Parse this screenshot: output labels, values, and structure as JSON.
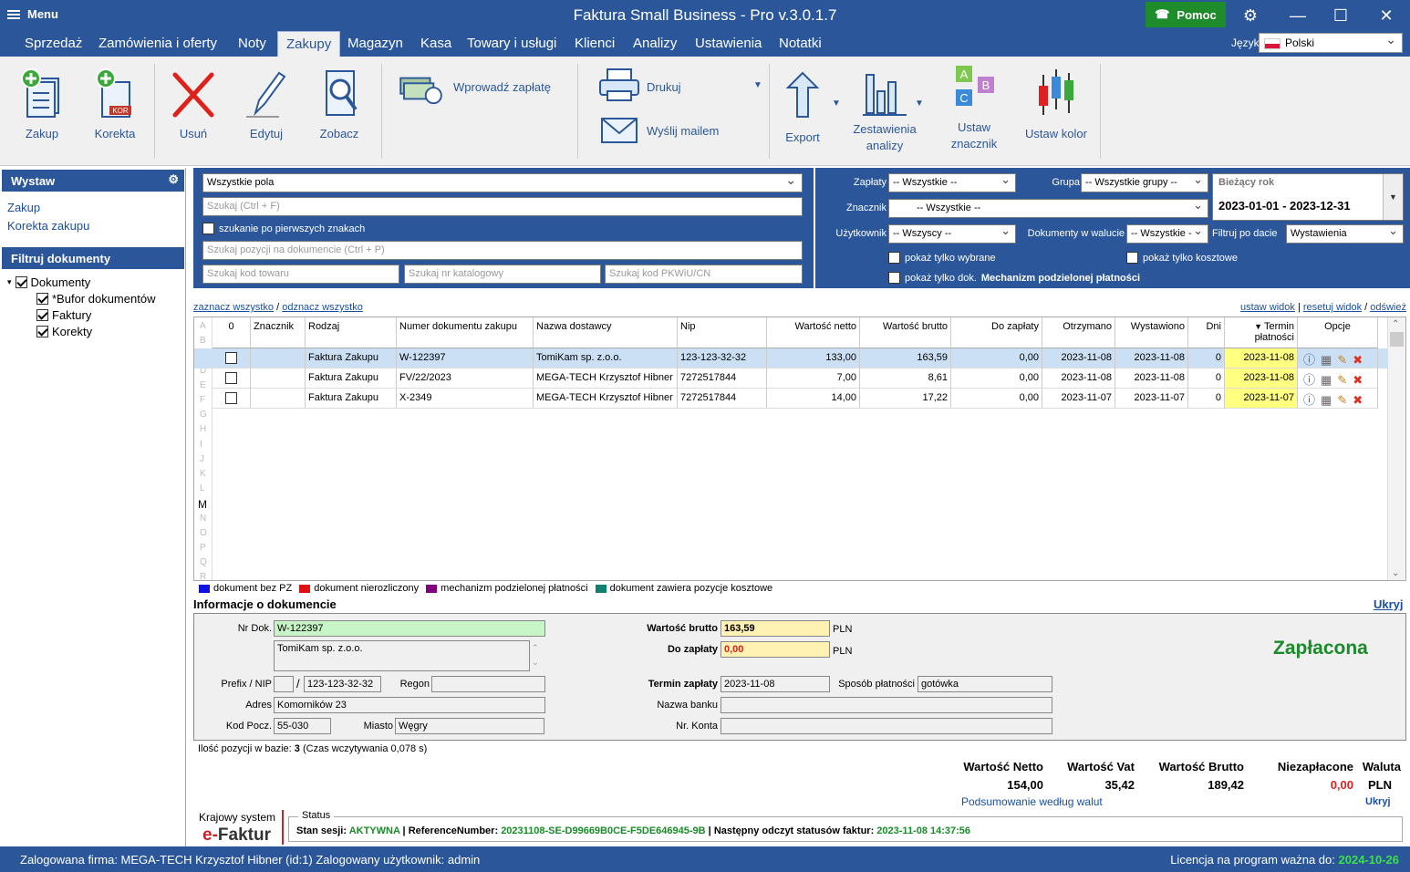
{
  "window": {
    "menu_label": "Menu",
    "title": "Faktura Small Business - Pro v.3.0.1.7",
    "help_label": "Pomoc"
  },
  "menubar": {
    "tabs": [
      "Sprzedaż",
      "Zamówienia i oferty",
      "Noty",
      "Zakupy",
      "Magazyn",
      "Kasa",
      "Towary i usługi",
      "Klienci",
      "Analizy",
      "Ustawienia",
      "Notatki"
    ],
    "active_tab": "Zakupy",
    "language_label": "Język",
    "language_value": "Polski"
  },
  "ribbon": {
    "zakup": "Zakup",
    "korekta": "Korekta",
    "usun": "Usuń",
    "edytuj": "Edytuj",
    "zobacz": "Zobacz",
    "wprowadz": "Wprowadź zapłatę",
    "drukuj": "Drukuj",
    "wyslij": "Wyślij mailem",
    "export": "Export",
    "zestawienia": "Zestawienia analizy",
    "znacznik": "Ustaw znacznik",
    "kolor": "Ustaw kolor",
    "kor_badge": "KOR"
  },
  "left": {
    "wystaw_title": "Wystaw",
    "wystaw_items": [
      "Zakup",
      "Korekta zakupu"
    ],
    "filter_title": "Filtruj dokumenty",
    "tree": [
      "Dokumenty",
      "*Bufor dokumentów",
      "Faktury",
      "Korekty"
    ]
  },
  "search": {
    "field_select": "Wszystkie pola",
    "search_placeholder": "Szukaj (Ctrl + F)",
    "first_chars_label": "szukanie po pierwszych znakach",
    "positions_placeholder": "Szukaj pozycji na dokumencie (Ctrl + P)",
    "code_placeholder": "Szukaj kod towaru",
    "catalog_placeholder": "Szukaj nr katalogowy",
    "pkwiu_placeholder": "Szukaj kod PKWiU/CN"
  },
  "filters": {
    "zaplaty_label": "Zapłaty",
    "zaplaty_value": "-- Wszystkie --",
    "grupa_label": "Grupa",
    "grupa_value": "-- Wszystkie grupy --",
    "znacznik_label": "Znacznik",
    "znacznik_value": "-- Wszystkie --",
    "uzytkownik_label": "Użytkownik",
    "uzytkownik_value": "-- Wszyscy --",
    "waluta_label": "Dokumenty w walucie",
    "waluta_value": "-- Wszystkie -",
    "period_label": "Bieżący rok",
    "period_value": "2023-01-01 - 2023-12-31",
    "filtruj_label": "Filtruj po dacie",
    "filtruj_value": "Wystawienia",
    "pokaz_wybrane": "pokaż tylko wybrane",
    "pokaz_kosztowe": "pokaż tylko kosztowe",
    "pokaz_mpp_prefix": "pokaż tylko dok.",
    "pokaz_mpp_bold": "Mechanizm podzielonej płatności"
  },
  "gridlinks": {
    "select_all": "zaznacz wszystko",
    "deselect_all": "odznacz wszystko",
    "set_view": "ustaw widok",
    "reset_view": "resetuj widok",
    "refresh": "odśwież"
  },
  "alphabet": [
    "A",
    "B",
    "C",
    "D",
    "E",
    "F",
    "G",
    "H",
    "I",
    "J",
    "K",
    "L",
    "M",
    "N",
    "O",
    "P",
    "Q",
    "R"
  ],
  "active_letter": "M",
  "table": {
    "headers": [
      "0",
      "Znacznik",
      "Rodzaj",
      "Numer dokumentu zakupu",
      "Nazwa dostawcy",
      "Nip",
      "Wartość netto",
      "Wartość brutto",
      "Do zapłaty",
      "Otrzymano",
      "Wystawiono",
      "Dni",
      "Termin płatności",
      "Opcje"
    ],
    "rows": [
      [
        "",
        "",
        "Faktura Zakupu",
        "W-122397",
        "TomiKam sp. z.o.o.",
        "123-123-32-32",
        "133,00",
        "163,59",
        "0,00",
        "2023-11-08",
        "2023-11-08",
        "0",
        "2023-11-08"
      ],
      [
        "",
        "",
        "Faktura Zakupu",
        "FV/22/2023",
        "MEGA-TECH Krzysztof Hibner",
        "7272517844",
        "7,00",
        "8,61",
        "0,00",
        "2023-11-08",
        "2023-11-08",
        "0",
        "2023-11-08"
      ],
      [
        "",
        "",
        "Faktura Zakupu",
        "X-2349",
        "MEGA-TECH Krzysztof Hibner",
        "7272517844",
        "14,00",
        "17,22",
        "0,00",
        "2023-11-07",
        "2023-11-07",
        "0",
        "2023-11-07"
      ]
    ]
  },
  "legend": [
    {
      "label": "dokument bez PZ",
      "color": "#1010e0"
    },
    {
      "label": "dokument nierozliczony",
      "color": "#e01010"
    },
    {
      "label": "mechanizm podzielonej płatności",
      "color": "#800080"
    },
    {
      "label": "dokument zawiera pozycje kosztowe",
      "color": "#108070"
    }
  ],
  "info": {
    "title": "Informacje o dokumencie",
    "hide": "Ukryj",
    "nr_label": "Nr Dok.",
    "nr_value": "W-122397",
    "name_value": "TomiKam sp. z.o.o.",
    "prefix_label": "Prefix / NIP",
    "prefix_value": "",
    "nip_value": "123-123-32-32",
    "slash": "/",
    "regon_label": "Regon",
    "regon_value": "",
    "adres_label": "Adres",
    "adres_value": "Komorników 23",
    "kod_label": "Kod Pocz.",
    "kod_value": "55-030",
    "miasto_label": "Miasto",
    "miasto_value": "Węgry",
    "brutto_label": "Wartość brutto",
    "brutto_value": "163,59",
    "brutto_cur": "PLN",
    "dozaplaty_label": "Do zapłaty",
    "dozaplaty_value": "0,00",
    "dozaplaty_cur": "PLN",
    "termin_label": "Termin zapłaty",
    "termin_value": "2023-11-08",
    "sposob_label": "Sposób płatności",
    "sposob_value": "gotówka",
    "bank_label": "Nazwa banku",
    "bank_value": "",
    "konto_label": "Nr. Konta",
    "konto_value": "",
    "status": "Zapłacona"
  },
  "footer": {
    "count_prefix": "Ilość pozycji w bazie:",
    "count_value": "3",
    "count_suffix": "(Czas wczytywania 0,078 s)",
    "netto_label": "Wartość Netto",
    "netto_value": "154,00",
    "vat_label": "Wartość Vat",
    "vat_value": "35,42",
    "brutto_label": "Wartość Brutto",
    "brutto_value": "189,42",
    "niezaplacone_label": "Niezapłacone",
    "niezaplacone_value": "0,00",
    "waluta_label": "Waluta",
    "waluta_value": "PLN",
    "summary_link": "Podsumowanie według walut",
    "hide": "Ukryj",
    "ksef_label": "Krajowy system",
    "ksef_logo_e": "e-",
    "ksef_logo_rest": "Faktur",
    "status_legend": "Status",
    "stan_label": "Stan sesji:",
    "stan_value": "AKTYWNA",
    "ref_label": "ReferenceNumber:",
    "ref_value": "20231108-SE-D99669B0CE-F5DE646945-9B",
    "next_label": "Następny odczyt statusów faktur:",
    "next_value": "2023-11-08 14:37:56"
  },
  "statusbar": {
    "left": "Zalogowana firma: MEGA-TECH Krzysztof Hibner (id:1) Zalogowany użytkownik: admin",
    "license_label": "Licencja na program ważna do:",
    "license_value": "2024-10-26"
  }
}
